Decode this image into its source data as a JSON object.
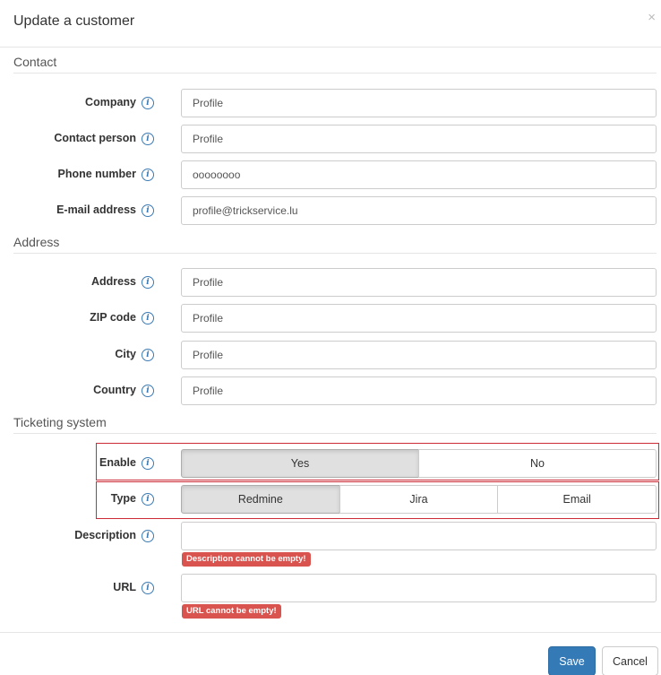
{
  "modal": {
    "title": "Update a customer",
    "close_symbol": "×"
  },
  "sections": {
    "contact": "Contact",
    "address": "Address",
    "ticketing": "Ticketing system"
  },
  "info_symbol": "i",
  "contact": {
    "company": {
      "label": "Company",
      "value": "Profile"
    },
    "contact_person": {
      "label": "Contact person",
      "value": "Profile"
    },
    "phone": {
      "label": "Phone number",
      "value": "oooooooo"
    },
    "email": {
      "label": "E-mail address",
      "value": "profile@trickservice.lu"
    }
  },
  "address": {
    "address": {
      "label": "Address",
      "value": "Profile"
    },
    "zip": {
      "label": "ZIP code",
      "value": "Profile"
    },
    "city": {
      "label": "City",
      "value": "Profile"
    },
    "country": {
      "label": "Country",
      "value": "Profile"
    }
  },
  "ticketing": {
    "enable": {
      "label": "Enable",
      "options": [
        "Yes",
        "No"
      ],
      "selected": "Yes"
    },
    "type": {
      "label": "Type",
      "options": [
        "Redmine",
        "Jira",
        "Email"
      ],
      "selected": "Redmine"
    },
    "description": {
      "label": "Description",
      "value": "",
      "error": "Description cannot be empty!"
    },
    "url": {
      "label": "URL",
      "value": "",
      "error": "URL cannot be empty!"
    }
  },
  "footer": {
    "save": "Save",
    "cancel": "Cancel"
  },
  "colors": {
    "primary": "#337ab7",
    "error": "#d9534f",
    "highlight": "#cc2a36",
    "info": "#3a7ab5"
  },
  "icons": {
    "info": "info-circle-icon",
    "close": "close-icon"
  }
}
